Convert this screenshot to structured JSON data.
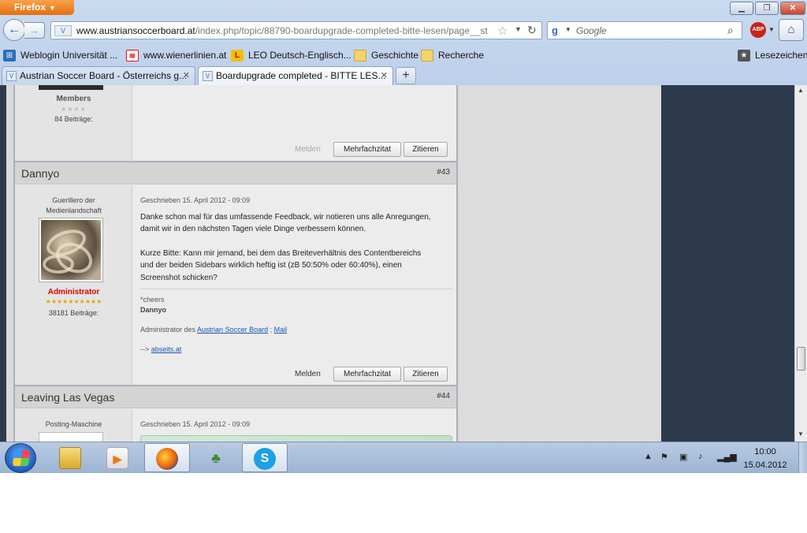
{
  "browser": {
    "app_button": "Firefox",
    "url_host": "www.austriansoccerboard.at",
    "url_path": "/index.php/topic/88790-boardupgrade-completed-bitte-lesen/page__st",
    "search_placeholder": "Google",
    "abp_label": "ABP",
    "bookmarks": [
      {
        "label": "Weblogin Universität ...",
        "icon": "network-icon"
      },
      {
        "label": "www.wienerlinien.at",
        "icon": "wienerlinien-icon"
      },
      {
        "label": "LEO Deutsch-Englisch...",
        "icon": "leo-icon"
      },
      {
        "label": "Geschichte",
        "icon": "folder-icon"
      },
      {
        "label": "Recherche",
        "icon": "folder-icon"
      }
    ],
    "bookmarks_menu": "Lesezeichen",
    "tabs": [
      {
        "label": "Austrian Soccer Board - Österreichs g...",
        "active": false
      },
      {
        "label": "Boardupgrade completed - BITTE LES...",
        "active": true
      }
    ]
  },
  "prev_post": {
    "rank": "Members",
    "stars": "★★★★",
    "posts_count": "84 Beiträge:",
    "report": "Melden",
    "multiquote": "Mehrfachzitat",
    "quote": "Zitieren"
  },
  "post_43": {
    "author": "Dannyo",
    "number": "#43",
    "title_line1": "Guerillero der",
    "title_line2": "Medienlandschaft",
    "rank": "Administrator",
    "stars": "★★★★★★★★★★",
    "posts_count": "38181 Beiträge:",
    "date": "Geschrieben 15. April 2012 - 09:09",
    "para1_line1": "Danke schon mal für das umfassende Feedback, wir notieren uns alle Anregungen,",
    "para1_line2": "damit wir in den nächsten Tagen viele Dinge verbessern können.",
    "para2_line1": "Kurze Bitte: Kann mir jemand, bei dem das Breiteverhältnis des Contentbereichs",
    "para2_line2": "und der beiden Sidebars wirklich heftig ist (zB 50:50% oder 60:40%), einen",
    "para2_line3": "Screenshot schicken?",
    "sig_cheers": "*cheers",
    "sig_name": "Dannyo",
    "sig_admin_prefix": "Administrator des",
    "sig_link_board": "Austrian Soccer Board",
    "sig_sep": ";",
    "sig_link_mail": "Mail",
    "sig_arrow": "-->",
    "sig_link_abseits": "abseits.at",
    "report": "Melden",
    "multiquote": "Mehrfachzitat",
    "quote": "Zitieren"
  },
  "post_44": {
    "author": "Leaving Las Vegas",
    "number": "#44",
    "rank_title": "Posting-Maschine",
    "date": "Geschrieben 15. April 2012 - 09:09"
  },
  "taskbar": {
    "time": "10:00",
    "date": "15.04.2012"
  }
}
